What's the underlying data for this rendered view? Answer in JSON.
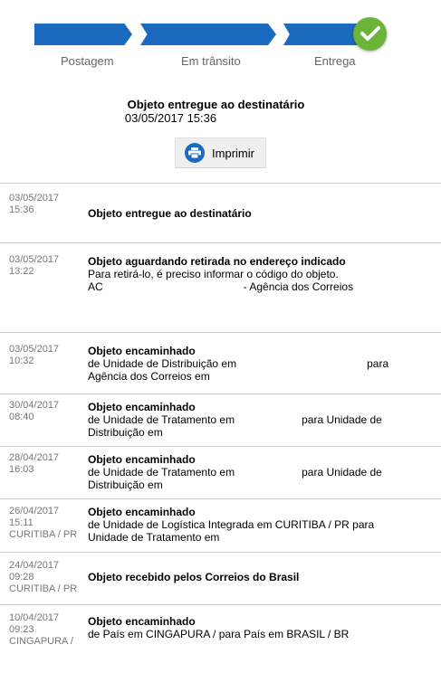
{
  "progress": {
    "steps": [
      "Postagem",
      "Em trânsito",
      "Entrega"
    ],
    "accent": "#1a6bc0",
    "done_color": "#6bb43a"
  },
  "summary": {
    "status": "Objeto entregue ao destinatário",
    "datetime": "03/05/2017 15:36"
  },
  "print_button": {
    "label": "Imprimir",
    "icon": "printer-icon"
  },
  "events": [
    {
      "date": "03/05/2017",
      "time": "15:36",
      "place": "",
      "title": "Objeto entregue ao destinatário",
      "lines": []
    },
    {
      "date": "03/05/2017",
      "time": "13:22",
      "place": "",
      "title": "Objeto aguardando retirada no endereço indicado",
      "lines": [
        "Para retirá-lo, é preciso informar o código do objeto.",
        "AC",
        "- Agência dos Correios"
      ]
    },
    {
      "date": "03/05/2017",
      "time": "10:32",
      "place": "",
      "title": "Objeto encaminhado",
      "lines": [
        "de Unidade de Distribuição em",
        "para",
        "Agência dos Correios em"
      ]
    },
    {
      "date": "30/04/2017",
      "time": "08:40",
      "place": "",
      "title": "Objeto encaminhado",
      "lines": [
        "de Unidade de Tratamento em",
        "para Unidade de",
        "Distribuição em"
      ]
    },
    {
      "date": "28/04/2017",
      "time": "16:03",
      "place": "",
      "title": "Objeto encaminhado",
      "lines": [
        "de Unidade de Tratamento em",
        "para Unidade de",
        "Distribuição em"
      ]
    },
    {
      "date": "26/04/2017",
      "time": "15:11",
      "place": "CURITIBA / PR",
      "title": "Objeto encaminhado",
      "lines": [
        "de Unidade de Logística Integrada em CURITIBA / PR para Unidade de Tratamento em"
      ]
    },
    {
      "date": "24/04/2017",
      "time": "09:28",
      "place": "CURITIBA / PR",
      "title": "Objeto recebido pelos Correios do Brasil",
      "lines": []
    },
    {
      "date": "10/04/2017",
      "time": "09:23",
      "place": "CINGAPURA /",
      "title": "Objeto encaminhado",
      "lines": [
        "de País em CINGAPURA / para País em BRASIL / BR"
      ]
    }
  ]
}
